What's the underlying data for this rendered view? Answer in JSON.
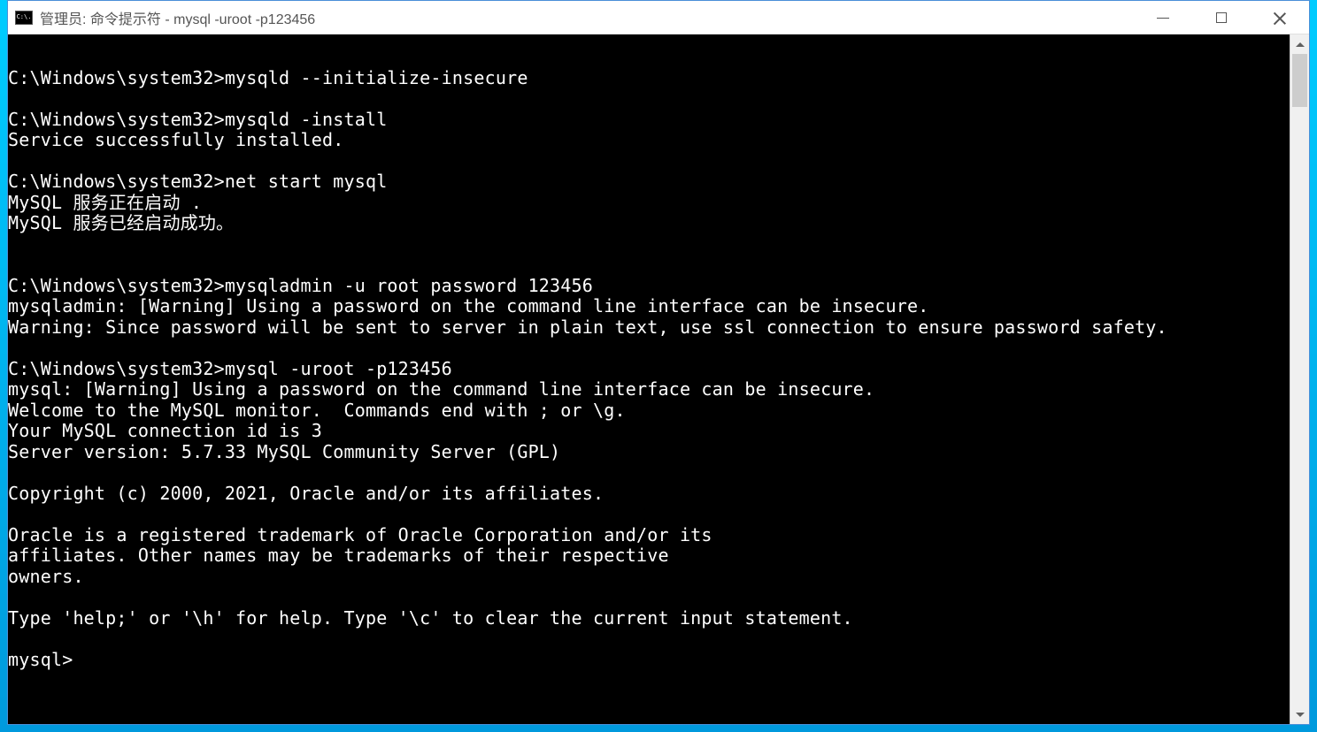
{
  "titlebar": {
    "icon_text": "C:\\.",
    "title": "管理员: 命令提示符 - mysql  -uroot -p123456"
  },
  "terminal": {
    "lines": [
      "",
      "C:\\Windows\\system32>mysqld --initialize-insecure",
      "",
      "C:\\Windows\\system32>mysqld -install",
      "Service successfully installed.",
      "",
      "C:\\Windows\\system32>net start mysql",
      "MySQL 服务正在启动 .",
      "MySQL 服务已经启动成功。",
      "",
      "",
      "C:\\Windows\\system32>mysqladmin -u root password 123456",
      "mysqladmin: [Warning] Using a password on the command line interface can be insecure.",
      "Warning: Since password will be sent to server in plain text, use ssl connection to ensure password safety.",
      "",
      "C:\\Windows\\system32>mysql -uroot -p123456",
      "mysql: [Warning] Using a password on the command line interface can be insecure.",
      "Welcome to the MySQL monitor.  Commands end with ; or \\g.",
      "Your MySQL connection id is 3",
      "Server version: 5.7.33 MySQL Community Server (GPL)",
      "",
      "Copyright (c) 2000, 2021, Oracle and/or its affiliates.",
      "",
      "Oracle is a registered trademark of Oracle Corporation and/or its",
      "affiliates. Other names may be trademarks of their respective",
      "owners.",
      "",
      "Type 'help;' or '\\h' for help. Type '\\c' to clear the current input statement.",
      "",
      "mysql>"
    ]
  }
}
